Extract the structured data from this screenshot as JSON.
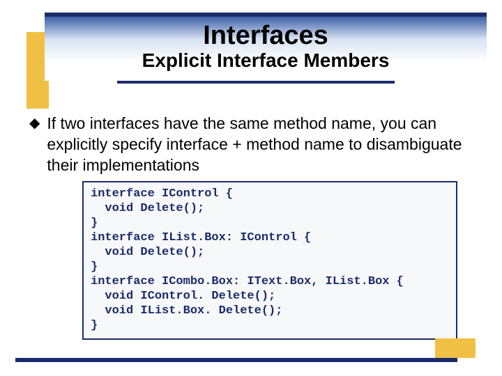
{
  "title": {
    "main": "Interfaces",
    "sub": "Explicit Interface Members"
  },
  "bullet": {
    "icon": "◆",
    "text": "If two interfaces have the same method name, you can explicitly specify interface + method name to disambiguate their implementations"
  },
  "code": "interface IControl {\n  void Delete();\n}\ninterface IList.Box: IControl {\n  void Delete();\n}\ninterface ICombo.Box: IText.Box, IList.Box {\n  void IControl. Delete();\n  void IList.Box. Delete();\n}",
  "colors": {
    "accent": "#1a2c6b",
    "highlight": "#f0c045"
  }
}
